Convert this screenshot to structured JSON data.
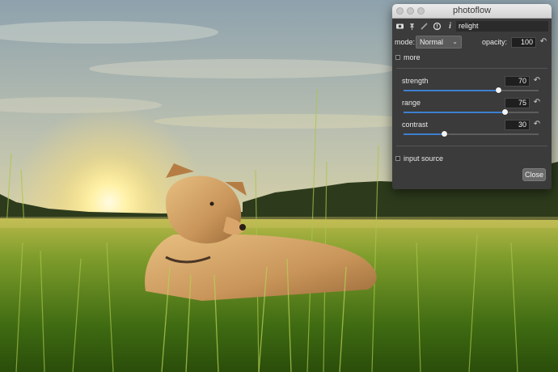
{
  "window": {
    "title": "photoflow"
  },
  "toolbar": {
    "icons": [
      "visibility-icon",
      "pin-icon",
      "edit-icon",
      "info-circle-icon",
      "italic-info-icon"
    ],
    "layer_name": "relight"
  },
  "blend": {
    "mode_label": "mode:",
    "mode_value": "Normal",
    "opacity_label": "opacity:",
    "opacity_value": "100"
  },
  "more": {
    "label": "more"
  },
  "sliders": [
    {
      "label": "strength",
      "value": "70",
      "fraction": 0.7
    },
    {
      "label": "range",
      "value": "75",
      "fraction": 0.75
    },
    {
      "label": "contrast",
      "value": "30",
      "fraction": 0.3
    }
  ],
  "input_source": {
    "label": "input source"
  },
  "close_label": "Close",
  "colors": {
    "accent": "#3f7fcf",
    "panel": "#3b3b3b",
    "field": "#1f1f1f"
  }
}
